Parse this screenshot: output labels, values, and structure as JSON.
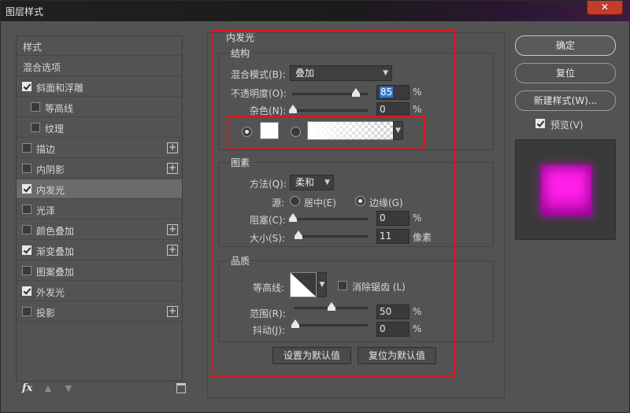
{
  "window": {
    "title": "图层样式",
    "close_label": "✕"
  },
  "left": {
    "items": [
      {
        "label": "样式",
        "checkbox": false,
        "checked": false,
        "plus": false,
        "active": false,
        "indent": false
      },
      {
        "label": "混合选项",
        "checkbox": false,
        "checked": false,
        "plus": false,
        "active": false,
        "indent": false
      },
      {
        "label": "斜面和浮雕",
        "checkbox": true,
        "checked": true,
        "plus": false,
        "active": false,
        "indent": false
      },
      {
        "label": "等高线",
        "checkbox": true,
        "checked": false,
        "plus": false,
        "active": false,
        "indent": true
      },
      {
        "label": "纹理",
        "checkbox": true,
        "checked": false,
        "plus": false,
        "active": false,
        "indent": true
      },
      {
        "label": "描边",
        "checkbox": true,
        "checked": false,
        "plus": true,
        "active": false,
        "indent": false
      },
      {
        "label": "内阴影",
        "checkbox": true,
        "checked": false,
        "plus": true,
        "active": false,
        "indent": false
      },
      {
        "label": "内发光",
        "checkbox": true,
        "checked": true,
        "plus": false,
        "active": true,
        "indent": false
      },
      {
        "label": "光泽",
        "checkbox": true,
        "checked": false,
        "plus": false,
        "active": false,
        "indent": false
      },
      {
        "label": "颜色叠加",
        "checkbox": true,
        "checked": false,
        "plus": true,
        "active": false,
        "indent": false
      },
      {
        "label": "渐变叠加",
        "checkbox": true,
        "checked": true,
        "plus": true,
        "active": false,
        "indent": false
      },
      {
        "label": "图案叠加",
        "checkbox": true,
        "checked": false,
        "plus": false,
        "active": false,
        "indent": false
      },
      {
        "label": "外发光",
        "checkbox": true,
        "checked": true,
        "plus": false,
        "active": false,
        "indent": false
      },
      {
        "label": "投影",
        "checkbox": true,
        "checked": false,
        "plus": true,
        "active": false,
        "indent": false
      }
    ],
    "plus_glyph": "+",
    "bottom": {
      "fx_label": "fx",
      "up_glyph": "▲",
      "down_glyph": "▼",
      "delete_icon": "trash-icon"
    }
  },
  "inner_glow": {
    "title": "内发光",
    "structure": {
      "title": "结构",
      "blend_mode_label": "混合模式(B):",
      "blend_mode_value": "叠加",
      "opacity_label": "不透明度(O):",
      "opacity_value": "85",
      "opacity_unit": "%",
      "opacity_level": 0.85,
      "noise_label": "杂色(N):",
      "noise_value": "0",
      "noise_unit": "%",
      "noise_level": 0
    },
    "elements": {
      "title": "图素",
      "method_label": "方法(Q):",
      "method_value": "柔和",
      "source_label": "源:",
      "source_center": "居中(E)",
      "source_edge": "边缘(G)",
      "choke_label": "阻塞(C):",
      "choke_value": "0",
      "choke_unit": "%",
      "choke_level": 0,
      "size_label": "大小(S):",
      "size_value": "11",
      "size_unit": "像素",
      "size_level": 0.04
    },
    "quality": {
      "title": "品质",
      "contour_label": "等高线:",
      "antialias_label": "消除锯齿 (L)",
      "range_label": "范围(R):",
      "range_value": "50",
      "range_unit": "%",
      "range_level": 0.5,
      "jitter_label": "抖动(J):",
      "jitter_value": "0",
      "jitter_unit": "%",
      "jitter_level": 0
    },
    "make_default": "设置为默认值",
    "reset_default": "复位为默认值"
  },
  "right": {
    "ok": "确定",
    "reset": "复位",
    "new_style": "新建样式(W)...",
    "preview_label": "预览(V)",
    "preview_checked": true,
    "preview_color": "#ff1ee9"
  },
  "colors": {
    "panel": "#535353",
    "highlight": "#e0141e",
    "accent": "#2f7ad6"
  }
}
